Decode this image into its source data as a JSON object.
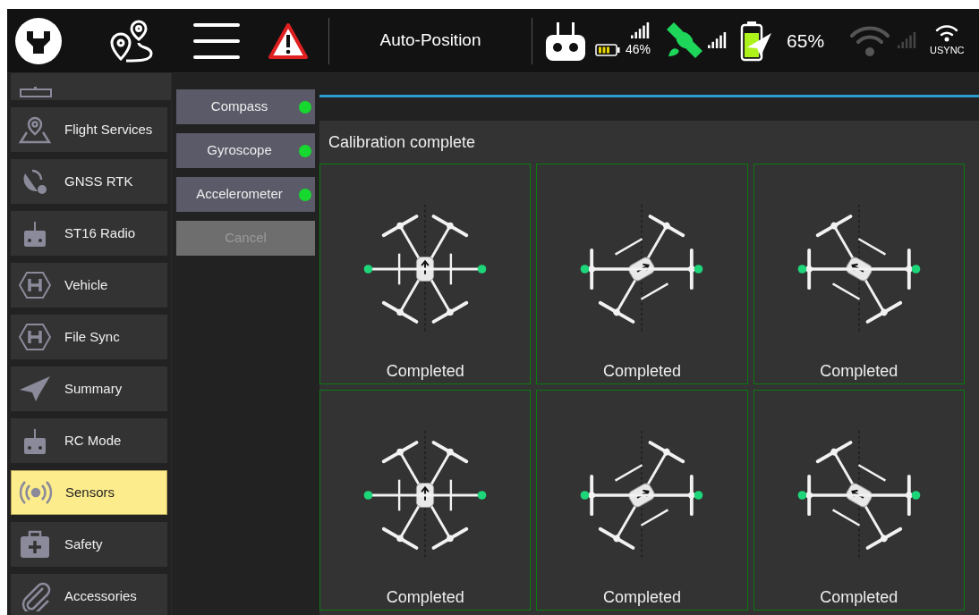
{
  "header": {
    "mode": "Auto-Position",
    "controller_battery": "46%",
    "vehicle_battery": "65%",
    "network": "USYNC"
  },
  "sidebar": {
    "items": [
      {
        "label": "Flight Services",
        "kind": "map",
        "selected": false
      },
      {
        "label": "GNSS RTK",
        "kind": "gnss",
        "selected": false
      },
      {
        "label": "ST16 Radio",
        "kind": "radio",
        "selected": false
      },
      {
        "label": "Vehicle",
        "kind": "hex",
        "selected": false
      },
      {
        "label": "File Sync",
        "kind": "hex",
        "selected": false
      },
      {
        "label": "Summary",
        "kind": "plane",
        "selected": false
      },
      {
        "label": "RC Mode",
        "kind": "radio",
        "selected": false
      },
      {
        "label": "Sensors",
        "kind": "sensor",
        "selected": true
      },
      {
        "label": "Safety",
        "kind": "kit",
        "selected": false
      },
      {
        "label": "Accessories",
        "kind": "clip",
        "selected": false
      }
    ]
  },
  "sensors": [
    {
      "label": "Compass",
      "kind": "status",
      "ok": true,
      "disabled": false
    },
    {
      "label": "Gyroscope",
      "kind": "status",
      "ok": true,
      "disabled": false
    },
    {
      "label": "Accelerometer",
      "kind": "status",
      "ok": true,
      "disabled": false
    },
    {
      "label": "Cancel",
      "kind": "action",
      "disabled": true
    }
  ],
  "calibration": {
    "title": "Calibration complete",
    "steps": [
      {
        "label": "Completed",
        "completed": true
      },
      {
        "label": "Completed",
        "completed": true
      },
      {
        "label": "Completed",
        "completed": true
      },
      {
        "label": "Completed",
        "completed": true
      },
      {
        "label": "Completed",
        "completed": true
      },
      {
        "label": "Completed",
        "completed": true
      }
    ]
  }
}
